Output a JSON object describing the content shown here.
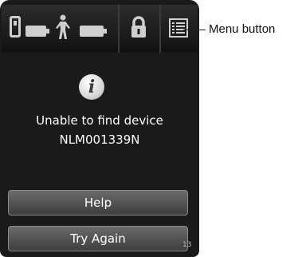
{
  "status_bar": {
    "icons": [
      "device-icon",
      "battery-icon",
      "person-icon",
      "battery-icon",
      "lock-icon",
      "menu-icon"
    ]
  },
  "info_icon_glyph": "i",
  "message": {
    "line1": "Unable to find device",
    "line2": "NLM001339N"
  },
  "buttons": {
    "help": "Help",
    "try_again": "Try Again"
  },
  "page_number": "13",
  "callout": {
    "label": "Menu button"
  },
  "colors": {
    "background": "#1a1a1a",
    "button": "#555555",
    "icon": "#cfcfcf"
  }
}
